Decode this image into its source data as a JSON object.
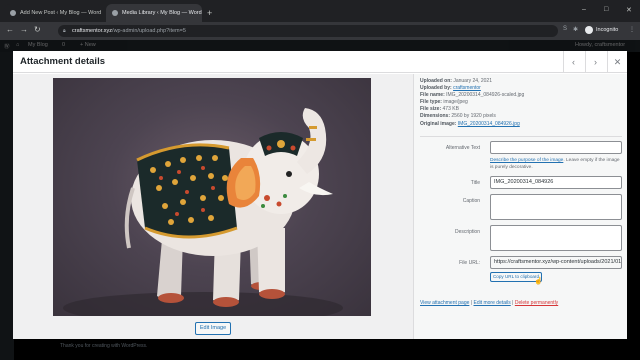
{
  "browser": {
    "tabs": [
      {
        "label": "Add New Post ‹ My Blog — Word"
      },
      {
        "label": "Media Library ‹ My Blog — Word"
      }
    ],
    "new_tab": "+",
    "address": {
      "host": "craftsmentor.xyz",
      "path": "/wp-admin/upload.php?item=5"
    },
    "incognito_label": "Incognito",
    "win_min": "–",
    "win_max": "□",
    "win_close": "✕"
  },
  "wp": {
    "site_name": "My Blog",
    "comments_count": "0",
    "new_label": "+ New",
    "howdy": "Howdy, craftsmentor",
    "footer": "Thank you for creating with WordPress."
  },
  "modal": {
    "title": "Attachment details",
    "prev": "‹",
    "next": "›",
    "close": "✕",
    "edit_image": "Edit Image"
  },
  "details": {
    "uploaded_on_label": "Uploaded on:",
    "uploaded_on": "January 24, 2021",
    "uploaded_by_label": "Uploaded by:",
    "uploaded_by": "craftsmentor",
    "file_name_label": "File name:",
    "file_name": "IMG_20200314_084926-scaled.jpg",
    "file_type_label": "File type:",
    "file_type": "image/jpeg",
    "file_size_label": "File size:",
    "file_size": "473 KB",
    "dimensions_label": "Dimensions:",
    "dimensions": "2560 by 1920 pixels",
    "original_label": "Original image:",
    "original": "IMG_20200314_084926.jpg"
  },
  "form": {
    "alt_label": "Alternative Text",
    "alt_value": "",
    "alt_help_link": "Describe the purpose of the image",
    "alt_help_rest": ". Leave empty if the image is purely decorative.",
    "title_label": "Title",
    "title_value": "IMG_20200314_084926",
    "caption_label": "Caption",
    "caption_value": "",
    "description_label": "Description",
    "description_value": "",
    "url_label": "File URL:",
    "url_value": "https://craftsmentor.xyz/wp-content/uploads/2021/01/IMG_20200314_084926-scaled.jpg",
    "copy_label": "Copy URL to clipboard"
  },
  "actions": {
    "view": "View attachment page",
    "sep1": "|",
    "edit": "Edit more details",
    "sep2": "|",
    "delete": "Delete permanently"
  },
  "colors": {
    "link": "#2271b1",
    "delete": "#d63638",
    "admin_bar": "#1d2327",
    "browser_dark": "#202124"
  }
}
